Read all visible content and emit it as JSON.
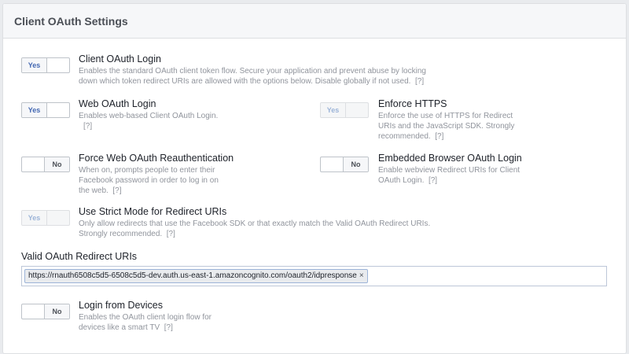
{
  "panel": {
    "title": "Client OAuth Settings"
  },
  "settings": {
    "client_oauth_login": {
      "toggle": "Yes",
      "title": "Client OAuth Login",
      "description_line1": "Enables the standard OAuth client token flow. Secure your application and prevent abuse by locking",
      "description_line2": "down which token redirect URIs are allowed with the options below. Disable globally if not used.",
      "help": "[?]"
    },
    "web_oauth_login": {
      "toggle": "Yes",
      "title": "Web OAuth Login",
      "description": "Enables web-based Client OAuth Login.",
      "help": "[?]"
    },
    "enforce_https": {
      "toggle": "Yes",
      "title": "Enforce HTTPS",
      "description_line1": "Enforce the use of HTTPS for Redirect",
      "description_line2": "URIs and the JavaScript SDK. Strongly",
      "description_line3": "recommended.",
      "help": "[?]"
    },
    "force_web_oauth_reauth": {
      "toggle": "No",
      "title": "Force Web OAuth Reauthentication",
      "description_line1": "When on, prompts people to enter their",
      "description_line2": "Facebook password in order to log in on",
      "description_line3": "the web.",
      "help": "[?]"
    },
    "embedded_browser_oauth": {
      "toggle": "No",
      "title": "Embedded Browser OAuth Login",
      "description_line1": "Enable webview Redirect URIs for Client",
      "description_line2": "OAuth Login.",
      "help": "[?]"
    },
    "strict_mode": {
      "toggle": "Yes",
      "title": "Use Strict Mode for Redirect URIs",
      "description_line1": "Only allow redirects that use the Facebook SDK or that exactly match the Valid OAuth Redirect URIs.",
      "description_line2": "Strongly recommended.",
      "help": "[?]"
    },
    "login_from_devices": {
      "toggle": "No",
      "title": "Login from Devices",
      "description_line1": "Enables the OAuth client login flow for",
      "description_line2": "devices like a smart TV",
      "help": "[?]"
    }
  },
  "redirect_uris": {
    "label": "Valid OAuth Redirect URIs",
    "values": [
      "https://rnauth6508c5d5-6508c5d5-dev.auth.us-east-1.amazoncognito.com/oauth2/idpresponse"
    ],
    "remove_glyph": "×"
  }
}
